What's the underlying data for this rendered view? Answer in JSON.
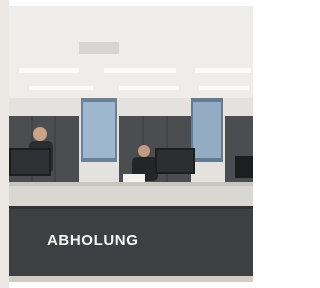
{
  "photo": {
    "description_tag": "pickup-counter-photo",
    "counter_sign_text": "ABHOLUNG",
    "colors": {
      "ceiling": "#eeede9",
      "wall": "#e4e2de",
      "cabinets": "#4b4d50",
      "counter_top": "#d9d7d2",
      "counter_front": "#3d3f42",
      "sign_text": "#f4f4f2",
      "floor": "#cfccc6"
    }
  }
}
